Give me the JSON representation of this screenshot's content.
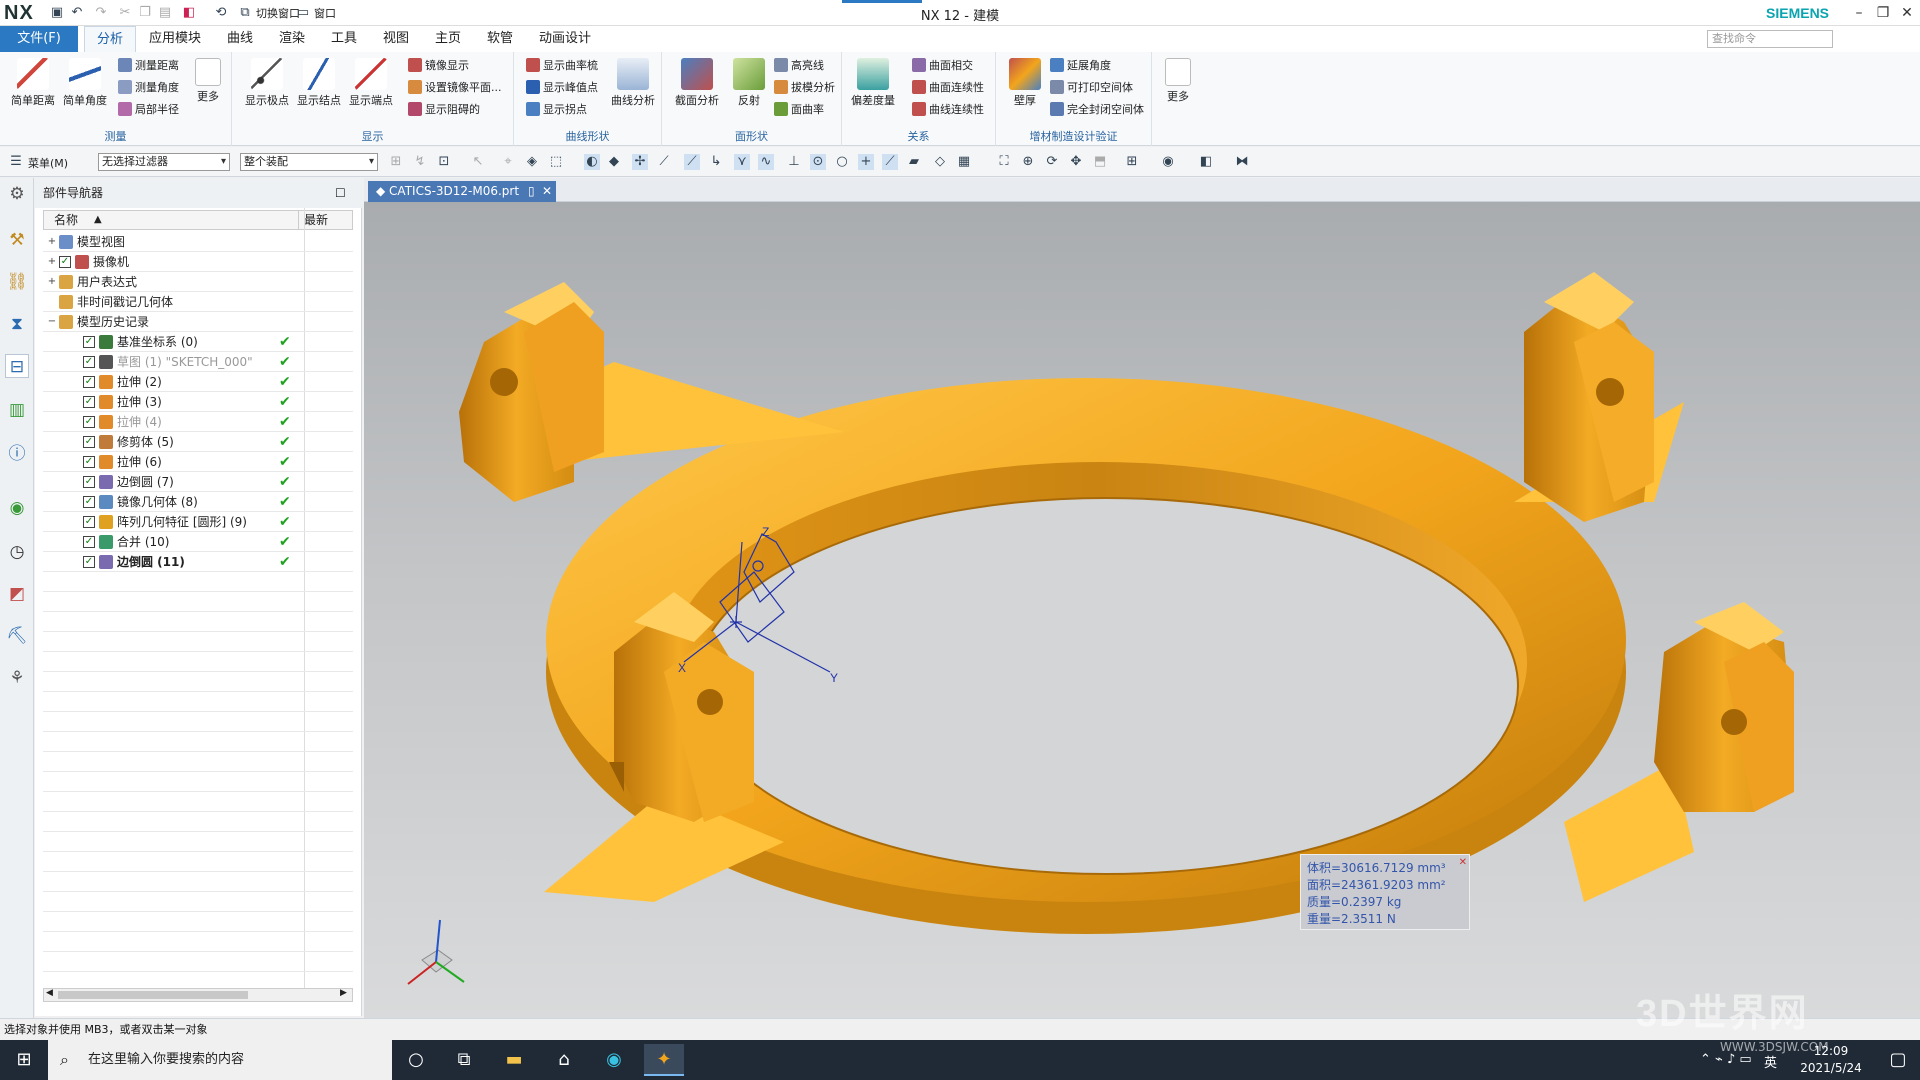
{
  "titlebar": {
    "logo": "NX",
    "window_title": "NX 12 - 建模",
    "switch_window": "切换窗口",
    "window_menu": "窗口",
    "brand": "SIEMENS"
  },
  "menubar": {
    "file": "文件(F)",
    "tabs": [
      "分析",
      "应用模块",
      "曲线",
      "渲染",
      "工具",
      "视图",
      "主页",
      "软管",
      "动画设计"
    ],
    "active_tab": "分析",
    "search_placeholder": "查找命令"
  },
  "ribbon": {
    "measure": {
      "label": "测量",
      "simple_distance": "简单距离",
      "simple_angle": "简单角度",
      "measure_distance": "测量距离",
      "measure_angle": "测量角度",
      "local_radius": "局部半径",
      "more": "更多"
    },
    "display": {
      "label": "显示",
      "show_poles": "显示极点",
      "show_knots": "显示结点",
      "show_endpoints": "显示端点",
      "mirror_display": "镜像显示",
      "set_mirror_plane": "设置镜像平面...",
      "show_blocker": "显示阻碍的"
    },
    "curve_shape": {
      "label": "曲线形状",
      "show_curvature_comb": "显示曲率梳",
      "show_peak_points": "显示峰值点",
      "show_inflections": "显示拐点",
      "curve_analysis": "曲线分析"
    },
    "face_shape": {
      "label": "面形状",
      "section_analysis": "截面分析",
      "reflection": "反射",
      "highlight_lines": "高亮线",
      "draft_analysis": "拔模分析",
      "face_curvature": "面曲率"
    },
    "relation": {
      "label": "关系",
      "deviation_gauge": "偏差度量",
      "face_intersection": "曲面相交",
      "face_continuity": "曲面连续性",
      "curve_continuity": "曲线连续性"
    },
    "am_validation": {
      "label": "增材制造设计验证",
      "wall_thickness": "壁厚",
      "overhang_angle": "延展角度",
      "printable_void": "可打印空间体",
      "closed_void": "完全封闭空间体",
      "more": "更多"
    }
  },
  "toolbar2": {
    "menu": "菜单(M)",
    "filter": "无选择过滤器",
    "scope": "整个装配"
  },
  "navigator": {
    "title": "部件导航器",
    "col_name": "名称",
    "col_latest": "最新",
    "items": [
      {
        "label": "模型视图",
        "level": 0,
        "expand": "+",
        "check": false,
        "ok": false,
        "grey": false,
        "bold": false
      },
      {
        "label": "摄像机",
        "level": 0,
        "expand": "+",
        "check": true,
        "ok": false,
        "grey": false,
        "bold": false
      },
      {
        "label": "用户表达式",
        "level": 0,
        "expand": "+",
        "check": false,
        "ok": false,
        "grey": false,
        "bold": false
      },
      {
        "label": "非时间戳记几何体",
        "level": 0,
        "expand": "",
        "check": false,
        "ok": false,
        "grey": false,
        "bold": false
      },
      {
        "label": "模型历史记录",
        "level": 0,
        "expand": "−",
        "check": false,
        "ok": false,
        "grey": false,
        "bold": false
      },
      {
        "label": "基准坐标系 (0)",
        "level": 1,
        "expand": "",
        "check": true,
        "ok": true,
        "grey": false,
        "bold": false
      },
      {
        "label": "草图 (1) \"SKETCH_000\"",
        "level": 1,
        "expand": "",
        "check": true,
        "ok": true,
        "grey": true,
        "bold": false
      },
      {
        "label": "拉伸 (2)",
        "level": 1,
        "expand": "",
        "check": true,
        "ok": true,
        "grey": false,
        "bold": false
      },
      {
        "label": "拉伸 (3)",
        "level": 1,
        "expand": "",
        "check": true,
        "ok": true,
        "grey": false,
        "bold": false
      },
      {
        "label": "拉伸 (4)",
        "level": 1,
        "expand": "",
        "check": true,
        "ok": true,
        "grey": true,
        "bold": false
      },
      {
        "label": "修剪体 (5)",
        "level": 1,
        "expand": "",
        "check": true,
        "ok": true,
        "grey": false,
        "bold": false
      },
      {
        "label": "拉伸 (6)",
        "level": 1,
        "expand": "",
        "check": true,
        "ok": true,
        "grey": false,
        "bold": false
      },
      {
        "label": "边倒圆 (7)",
        "level": 1,
        "expand": "",
        "check": true,
        "ok": true,
        "grey": false,
        "bold": false
      },
      {
        "label": "镜像几何体 (8)",
        "level": 1,
        "expand": "",
        "check": true,
        "ok": true,
        "grey": false,
        "bold": false
      },
      {
        "label": "阵列几何特征 [圆形] (9)",
        "level": 1,
        "expand": "",
        "check": true,
        "ok": true,
        "grey": false,
        "bold": false
      },
      {
        "label": "合并 (10)",
        "level": 1,
        "expand": "",
        "check": true,
        "ok": true,
        "grey": false,
        "bold": false
      },
      {
        "label": "边倒圆 (11)",
        "level": 1,
        "expand": "",
        "check": true,
        "ok": true,
        "grey": false,
        "bold": true
      }
    ]
  },
  "document": {
    "tab_label": "CATICS-3D12-M06.prt"
  },
  "measure_info": {
    "volume": "体积=30616.7129 mm³",
    "area": "面积=24361.9203 mm²",
    "mass": "质量=0.2397 kg",
    "weight": "重量=2.3511 N"
  },
  "csys_labels": {
    "x": "X",
    "y": "Y",
    "z": "Z"
  },
  "status": {
    "message": "选择对象并使用 MB3，或者双击某一对象"
  },
  "taskbar": {
    "search_placeholder": "在这里输入你要搜索的内容",
    "ime": "英",
    "time": "12:09",
    "date": "2021/5/24"
  },
  "watermark": {
    "text": "3D世界网",
    "url": "WWW.3DSJW.COM"
  },
  "colors": {
    "part": "#f2a51c",
    "part_dark": "#c07a0a",
    "part_light": "#ffc84a",
    "accent": "#2b79c2",
    "ok": "#1ea31e"
  }
}
